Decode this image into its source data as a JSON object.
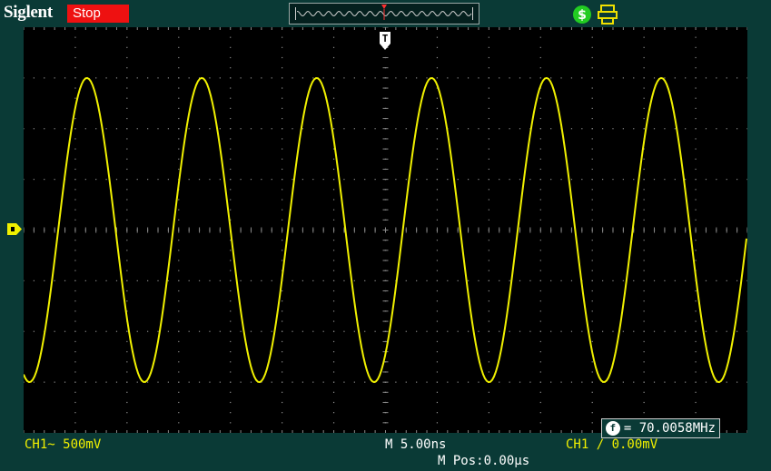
{
  "header": {
    "brand": "Siglent",
    "run_state": "Stop",
    "icons": [
      "waveform-overview-icon",
      "trigger-position-icon",
      "usb-connection-icon",
      "printer-icon"
    ]
  },
  "colors": {
    "background": "#0a3a36",
    "screen": "#000000",
    "grid": "#8a8a8a",
    "channel1": "#f0f000",
    "stop": "#ee1111"
  },
  "screen": {
    "trigger_marker": "T",
    "grid": "on"
  },
  "measurement": {
    "label": "f",
    "value": "= 70.0058MHz"
  },
  "footer": {
    "ch1_scale": "CH1~ 500mV",
    "timebase": "M 5.00ns",
    "trigger_info": "CH1 ∕ 0.00mV",
    "horizontal_position": "M Pos:0.00μs"
  },
  "chart_data": {
    "type": "line",
    "title": "",
    "xlabel": "",
    "ylabel": "",
    "x_divisions": 14,
    "y_divisions": 8,
    "series": [
      {
        "frequency_mhz": 70.0058,
        "peak_div": 3.0,
        "trough_div": -3.0,
        "cycles_on_screen": 6.3
      }
    ],
    "grid": "on"
  }
}
